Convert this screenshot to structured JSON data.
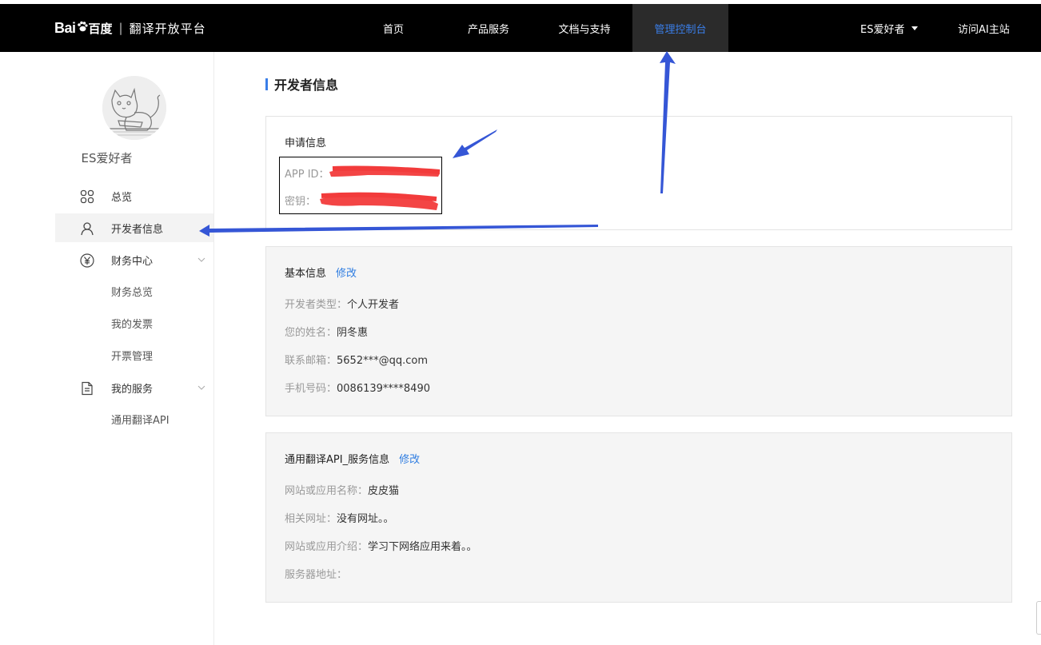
{
  "header": {
    "logo_bai": "Bai",
    "logo_du": "百度",
    "logo_separator": "|",
    "platform": "翻译开放平台",
    "nav": [
      "首页",
      "产品服务",
      "文档与支持",
      "管理控制台"
    ],
    "active_nav": "管理控制台",
    "user": "ES爱好者",
    "visit": "访问AI主站"
  },
  "sidebar": {
    "username": "ES爱好者",
    "items": [
      {
        "label": "总览",
        "icon": "grid-icon"
      },
      {
        "label": "开发者信息",
        "icon": "user-icon",
        "active": true
      },
      {
        "label": "财务中心",
        "icon": "yen-icon",
        "expandable": true
      },
      {
        "label": "我的服务",
        "icon": "document-icon",
        "expandable": true
      }
    ],
    "finance_sub": [
      "财务总览",
      "我的发票",
      "开票管理"
    ],
    "service_sub": [
      "通用翻译API"
    ]
  },
  "main": {
    "title": "开发者信息",
    "apply": {
      "heading": "申请信息",
      "appid_label": "APP ID：",
      "secret_label": "密钥："
    },
    "basic": {
      "heading": "基本信息",
      "edit": "修改",
      "rows": [
        {
          "k": "开发者类型：",
          "v": "个人开发者"
        },
        {
          "k": "您的姓名：",
          "v": "阴冬惠"
        },
        {
          "k": "联系邮箱：",
          "v": "5652***@qq.com"
        },
        {
          "k": "手机号码：",
          "v": "0086139****8490"
        }
      ]
    },
    "service": {
      "heading": "通用翻译API_服务信息",
      "edit": "修改",
      "rows": [
        {
          "k": "网站或应用名称：",
          "v": "皮皮猫"
        },
        {
          "k": "相关网址：",
          "v": "没有网址。。"
        },
        {
          "k": "网站或应用介绍：",
          "v": "学习下网络应用来着。。"
        },
        {
          "k": "服务器地址：",
          "v": ""
        }
      ]
    }
  },
  "colors": {
    "accent": "#3a7ee8",
    "topbar": "#000000",
    "redaction": "#f23b3b",
    "annotation_arrow": "#3556d6"
  }
}
